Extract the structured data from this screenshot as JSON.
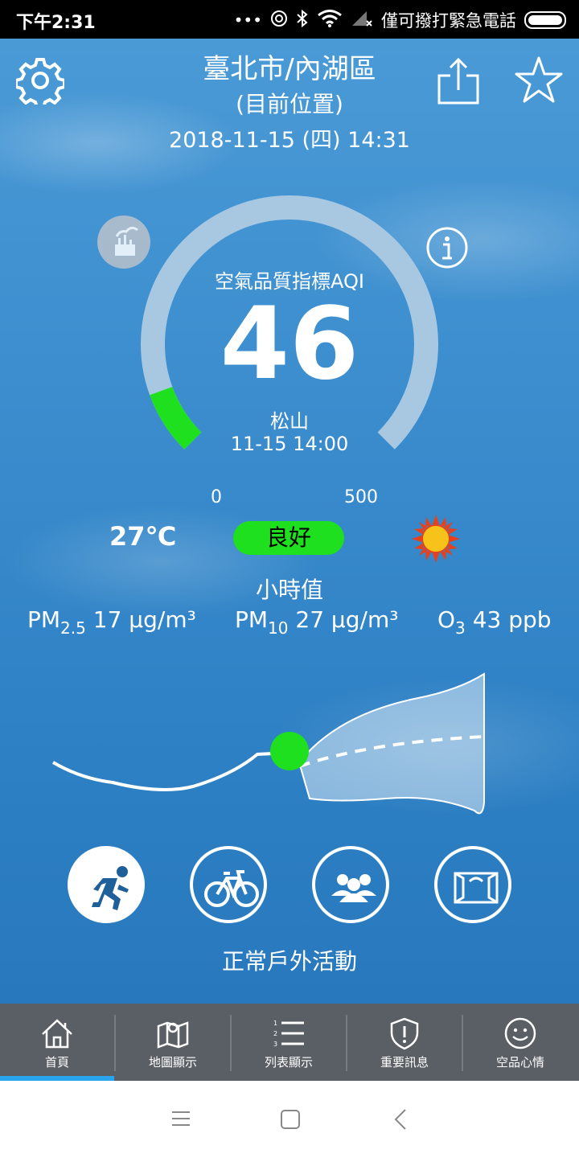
{
  "status_bar": {
    "time": "下午2:31",
    "dots": "•••",
    "carrier_text": "僅可撥打緊急電話"
  },
  "header": {
    "location": "臺北市/內湖區",
    "location_note": "(目前位置)",
    "datetime": "2018-11-15 (四) 14:31"
  },
  "aqi": {
    "label": "空氣品質指標AQI",
    "value": "46",
    "value_num": 46,
    "scale_min": "0",
    "scale_max": "500",
    "station": "松山",
    "observed_time": "11-15 14:00",
    "status": "良好",
    "status_color": "#1ee01e",
    "gauge_color": "#a8c8e2"
  },
  "weather": {
    "temperature": "27℃",
    "icon": "sun-icon"
  },
  "pollutants": {
    "title": "小時值",
    "pm25": {
      "name": "PM",
      "sub": "2.5",
      "value": "17 μg/m³"
    },
    "pm10": {
      "name": "PM",
      "sub": "10",
      "value": "27 μg/m³"
    },
    "o3": {
      "name": "O",
      "sub": "3",
      "value": "43 ppb"
    }
  },
  "activities": {
    "items": [
      "running-icon",
      "bicycle-icon",
      "group-icon",
      "window-icon"
    ],
    "selected_label": "正常戶外活動"
  },
  "tabs": [
    {
      "label": "首頁",
      "icon": "home-icon",
      "active": true
    },
    {
      "label": "地圖顯示",
      "icon": "map-icon",
      "active": false
    },
    {
      "label": "列表顯示",
      "icon": "list-icon",
      "active": false
    },
    {
      "label": "重要訊息",
      "icon": "alert-shield-icon",
      "active": false
    },
    {
      "label": "空品心情",
      "icon": "smiley-icon",
      "active": false
    }
  ],
  "colors": {
    "accent": "#29a5ee",
    "tab_bg": "#5a5f66"
  }
}
